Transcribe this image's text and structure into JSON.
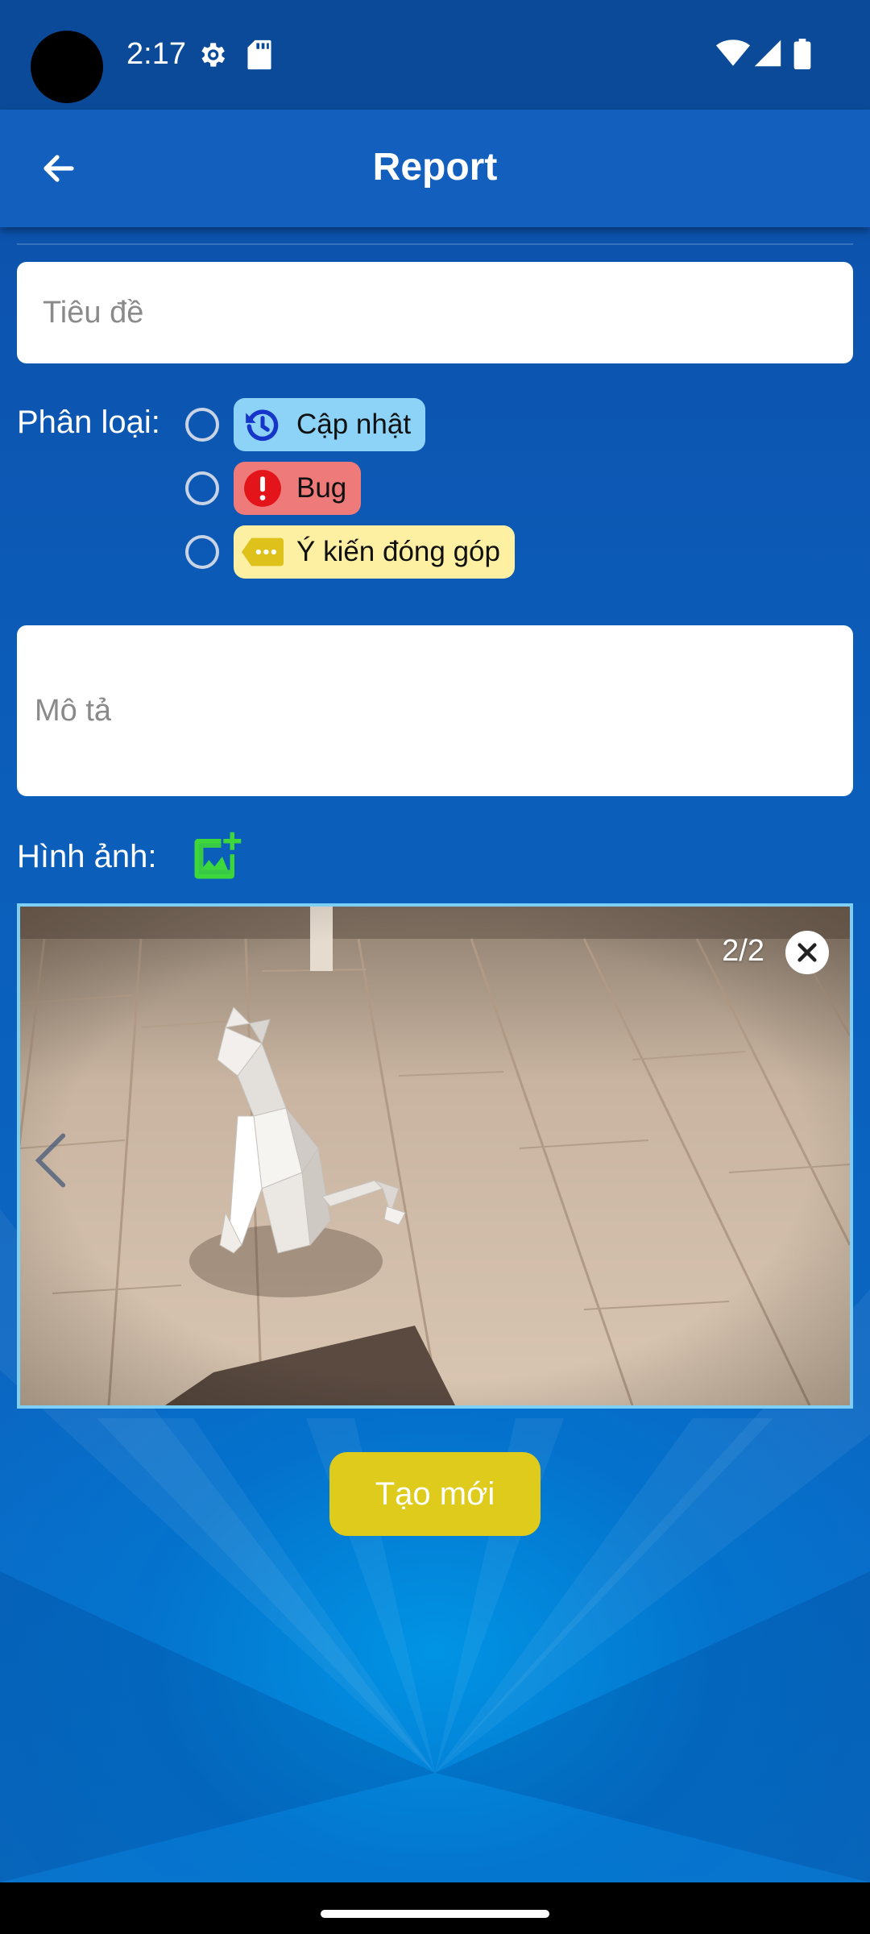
{
  "status_bar": {
    "time": "2:17",
    "icons": [
      "settings-icon",
      "sd-card-icon",
      "wifi-icon",
      "signal-icon",
      "battery-icon"
    ]
  },
  "app_bar": {
    "title": "Report",
    "back_icon": "arrow-left-icon"
  },
  "form": {
    "title_placeholder": "Tiêu đề",
    "category_label": "Phân loại:",
    "categories": [
      {
        "label": "Cập nhật",
        "icon": "update-clock-icon",
        "color": "#8dd3f8",
        "selected": false
      },
      {
        "label": "Bug",
        "icon": "error-icon",
        "color": "#ef7a7a",
        "selected": false
      },
      {
        "label": "Ý kiến đóng góp",
        "icon": "tag-dots-icon",
        "color": "#fdf0a2",
        "selected": false
      }
    ],
    "description_placeholder": "Mô tả",
    "images_label": "Hình ảnh:",
    "add_image_icon": "add-photo-icon"
  },
  "image_viewer": {
    "counter": "2/2",
    "border_color": "#7dcff5"
  },
  "submit": {
    "label": "Tạo mới",
    "color": "#dfcb1c"
  },
  "colors": {
    "app_bar": "#135fbe",
    "status_bar": "#0a4a98",
    "add_image_icon": "#3dd63b"
  }
}
